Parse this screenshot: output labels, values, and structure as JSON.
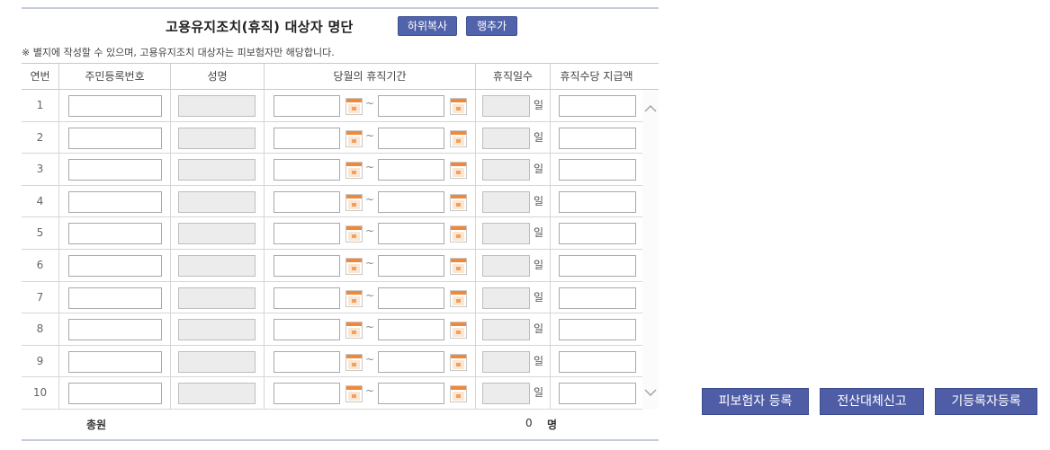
{
  "header": {
    "title": "고용유지조치(휴직) 대상자 명단",
    "copy_button": "하위복사",
    "add_row_button": "행추가"
  },
  "note": "※ 별지에 작성할 수 있으며, 고용유지조치 대상자는 피보험자만 해당합니다.",
  "table": {
    "columns": [
      "연번",
      "주민등록번호",
      "성명",
      "당월의 휴직기간",
      "휴직일수",
      "휴직수당 지급액"
    ],
    "rows": [
      {
        "no": "1",
        "ssn": "",
        "name": "",
        "start": "",
        "end": "",
        "days": "",
        "allowance": "",
        "day_unit": "일"
      },
      {
        "no": "2",
        "ssn": "",
        "name": "",
        "start": "",
        "end": "",
        "days": "",
        "allowance": "",
        "day_unit": "일"
      },
      {
        "no": "3",
        "ssn": "",
        "name": "",
        "start": "",
        "end": "",
        "days": "",
        "allowance": "",
        "day_unit": "일"
      },
      {
        "no": "4",
        "ssn": "",
        "name": "",
        "start": "",
        "end": "",
        "days": "",
        "allowance": "",
        "day_unit": "일"
      },
      {
        "no": "5",
        "ssn": "",
        "name": "",
        "start": "",
        "end": "",
        "days": "",
        "allowance": "",
        "day_unit": "일"
      },
      {
        "no": "6",
        "ssn": "",
        "name": "",
        "start": "",
        "end": "",
        "days": "",
        "allowance": "",
        "day_unit": "일"
      },
      {
        "no": "7",
        "ssn": "",
        "name": "",
        "start": "",
        "end": "",
        "days": "",
        "allowance": "",
        "day_unit": "일"
      },
      {
        "no": "8",
        "ssn": "",
        "name": "",
        "start": "",
        "end": "",
        "days": "",
        "allowance": "",
        "day_unit": "일"
      },
      {
        "no": "9",
        "ssn": "",
        "name": "",
        "start": "",
        "end": "",
        "days": "",
        "allowance": "",
        "day_unit": "일"
      },
      {
        "no": "10",
        "ssn": "",
        "name": "",
        "start": "",
        "end": "",
        "days": "",
        "allowance": "",
        "day_unit": "일"
      }
    ],
    "range_separator": "~"
  },
  "total": {
    "label": "총원",
    "count": "0",
    "unit": "명"
  },
  "actions": {
    "register_insured": "피보험자 등록",
    "electronic_report": "전산대체신고",
    "registered_enroll": "기등록자등록"
  },
  "colors": {
    "button_bg": "#5163ab",
    "calendar_orange": "#f0883a",
    "rule_line": "#c5cadb"
  },
  "icons": {
    "calendar": "calendar-icon",
    "scroll_up": "chevron-up-icon",
    "scroll_down": "chevron-down-icon"
  }
}
